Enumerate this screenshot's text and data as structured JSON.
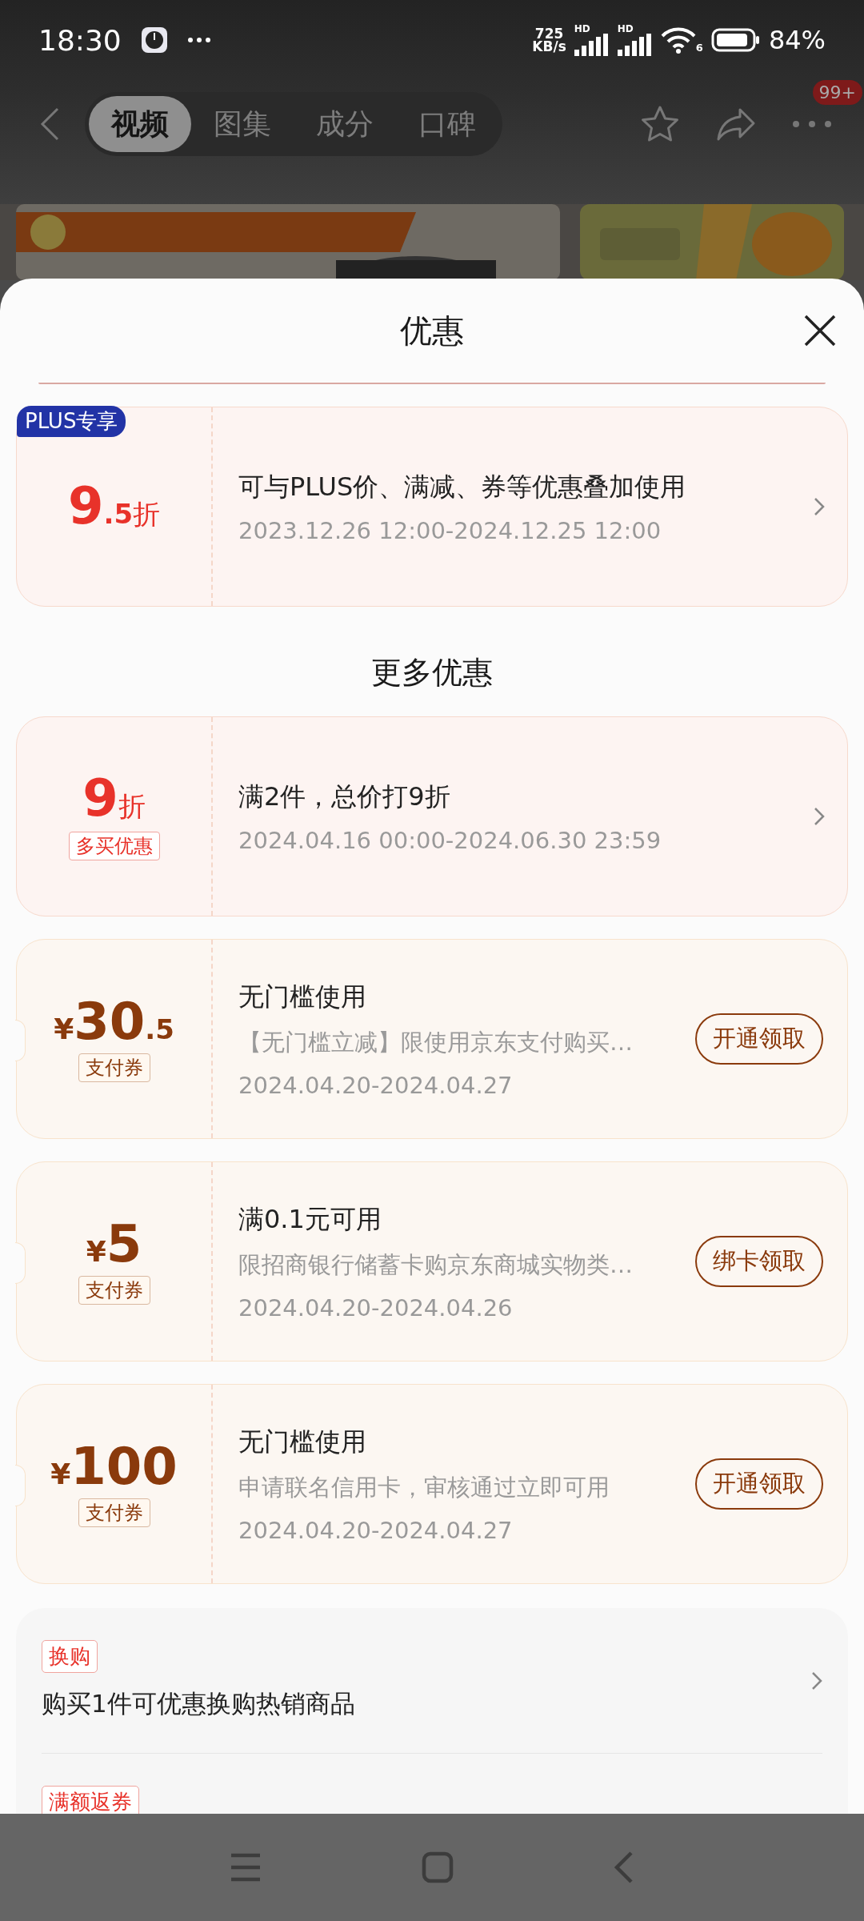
{
  "status_bar": {
    "time": "18:30",
    "network_speed": "725",
    "network_unit": "KB/s",
    "signals": [
      {
        "label": "HD"
      },
      {
        "label": "HD"
      }
    ],
    "wifi_label": "6",
    "battery": "84%"
  },
  "nav": {
    "tabs": [
      {
        "label": "视频",
        "selected": true
      },
      {
        "label": "图集",
        "selected": false
      },
      {
        "label": "成分",
        "selected": false
      },
      {
        "label": "口碑",
        "selected": false
      }
    ],
    "badge": "99+"
  },
  "sheet": {
    "title": "优惠",
    "plus_coupons": [
      {
        "kind": "discount",
        "badge": "PLUS专享",
        "integer": "9",
        "fraction": ".5",
        "unit": "折",
        "title": "可与PLUS价、满减、券等优惠叠加使用",
        "validity": "2023.12.26 12:00-2024.12.25 12:00"
      }
    ],
    "more_title": "更多优惠",
    "coupons": [
      {
        "kind": "discount",
        "integer": "9",
        "unit": "折",
        "tag": "多买优惠",
        "title": "满2件，总价打9折",
        "validity": "2024.04.16 00:00-2024.06.30 23:59"
      },
      {
        "kind": "payment",
        "currency": "¥",
        "integer": "30",
        "fraction": ".5",
        "tag": "支付券",
        "title": "无门槛使用",
        "description": "【无门槛立减】限使用京东支付购买…",
        "validity": "2024.04.20-2024.04.27",
        "action": "开通领取"
      },
      {
        "kind": "payment",
        "currency": "¥",
        "integer": "5",
        "tag": "支付券",
        "title": "满0.1元可用",
        "description": "限招商银行储蓄卡购京东商城实物类…",
        "validity": "2024.04.20-2024.04.26",
        "action": "绑卡领取"
      },
      {
        "kind": "payment",
        "currency": "¥",
        "integer": "100",
        "tag": "支付券",
        "title": "无门槛使用",
        "description": "申请联名信用卡，审核通过立即可用",
        "validity": "2024.04.20-2024.04.27",
        "action": "开通领取"
      }
    ],
    "offers": [
      {
        "tag": "换购",
        "text": "购买1件可优惠换购热销商品"
      },
      {
        "tag": "满额返券"
      }
    ]
  }
}
